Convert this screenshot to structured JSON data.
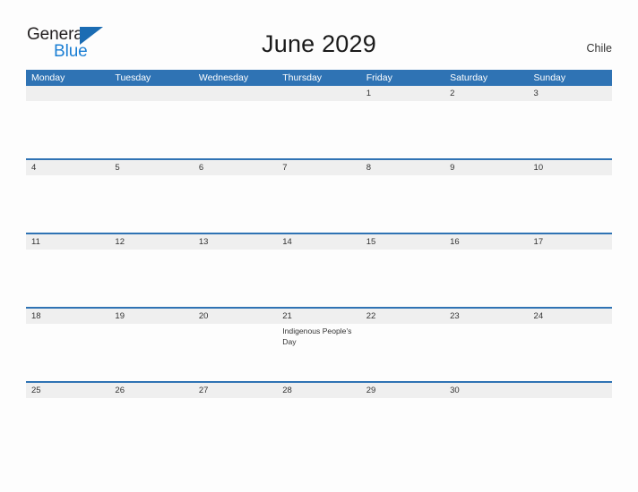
{
  "brand": {
    "name_part1": "General",
    "name_part2": "Blue",
    "flag_icon": "blue-triangle-flag-icon",
    "color_dark": "#231f20",
    "color_blue": "#1b7fd4"
  },
  "header": {
    "title": "June 2029",
    "country": "Chile"
  },
  "theme": {
    "header_blue": "#2f73b4",
    "date_strip_gray": "#efefef",
    "page_background": "#fdfdfd",
    "text_color": "#333333"
  },
  "calendar": {
    "weekdays": [
      "Monday",
      "Tuesday",
      "Wednesday",
      "Thursday",
      "Friday",
      "Saturday",
      "Sunday"
    ],
    "weeks": [
      {
        "days": [
          {
            "date": "",
            "event": ""
          },
          {
            "date": "",
            "event": ""
          },
          {
            "date": "",
            "event": ""
          },
          {
            "date": "",
            "event": ""
          },
          {
            "date": "1",
            "event": ""
          },
          {
            "date": "2",
            "event": ""
          },
          {
            "date": "3",
            "event": ""
          }
        ]
      },
      {
        "days": [
          {
            "date": "4",
            "event": ""
          },
          {
            "date": "5",
            "event": ""
          },
          {
            "date": "6",
            "event": ""
          },
          {
            "date": "7",
            "event": ""
          },
          {
            "date": "8",
            "event": ""
          },
          {
            "date": "9",
            "event": ""
          },
          {
            "date": "10",
            "event": ""
          }
        ]
      },
      {
        "days": [
          {
            "date": "11",
            "event": ""
          },
          {
            "date": "12",
            "event": ""
          },
          {
            "date": "13",
            "event": ""
          },
          {
            "date": "14",
            "event": ""
          },
          {
            "date": "15",
            "event": ""
          },
          {
            "date": "16",
            "event": ""
          },
          {
            "date": "17",
            "event": ""
          }
        ]
      },
      {
        "days": [
          {
            "date": "18",
            "event": ""
          },
          {
            "date": "19",
            "event": ""
          },
          {
            "date": "20",
            "event": ""
          },
          {
            "date": "21",
            "event": "Indigenous People's Day"
          },
          {
            "date": "22",
            "event": ""
          },
          {
            "date": "23",
            "event": ""
          },
          {
            "date": "24",
            "event": ""
          }
        ]
      },
      {
        "days": [
          {
            "date": "25",
            "event": ""
          },
          {
            "date": "26",
            "event": ""
          },
          {
            "date": "27",
            "event": ""
          },
          {
            "date": "28",
            "event": ""
          },
          {
            "date": "29",
            "event": ""
          },
          {
            "date": "30",
            "event": ""
          },
          {
            "date": "",
            "event": ""
          }
        ]
      }
    ]
  }
}
